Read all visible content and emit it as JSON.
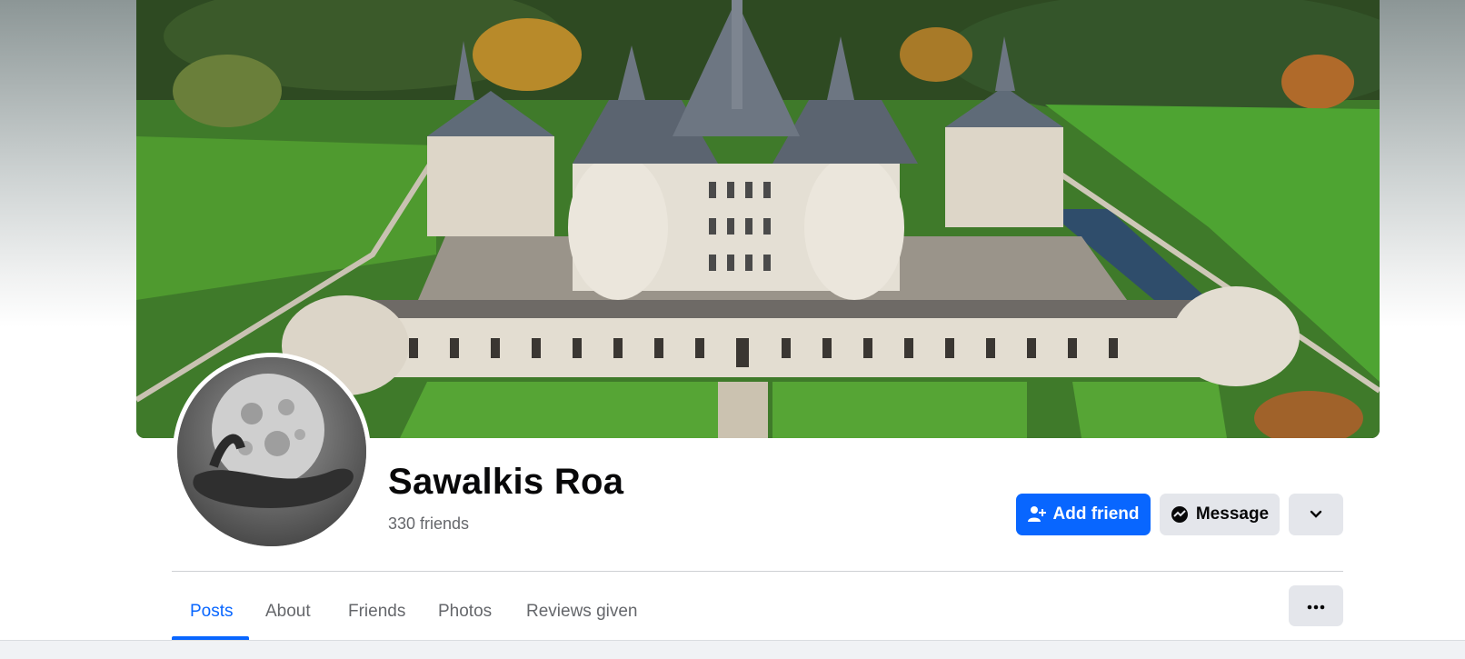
{
  "profile": {
    "name": "Sawalkis Roa",
    "friends_count": "330 friends"
  },
  "actions": {
    "add_friend_label": "Add friend",
    "message_label": "Message",
    "more_icon": "chevron-down-icon"
  },
  "tabs": [
    {
      "label": "Posts",
      "active": true
    },
    {
      "label": "About",
      "active": false
    },
    {
      "label": "Friends",
      "active": false
    },
    {
      "label": "Photos",
      "active": false
    },
    {
      "label": "Reviews given",
      "active": false
    }
  ],
  "colors": {
    "accent": "#0866ff",
    "button_secondary": "#e4e6eb",
    "text_primary": "#080809",
    "text_secondary": "#65676b"
  },
  "icons": {
    "add_friend": "person-plus-icon",
    "message": "messenger-icon",
    "tab_more": "ellipsis-icon"
  }
}
